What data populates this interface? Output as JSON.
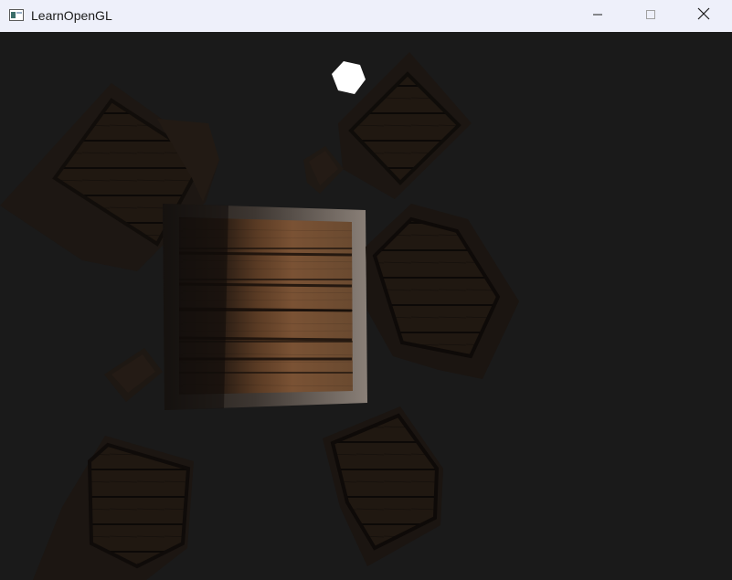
{
  "window": {
    "title": "LearnOpenGL",
    "app_icon": "window-app-icon",
    "controls": {
      "minimize_icon": "minimize-icon",
      "maximize_icon": "maximize-icon",
      "close_icon": "close-icon"
    }
  },
  "scene": {
    "background_color": "#1a1a1a",
    "light_color": "#ffffff",
    "crate_wood_color": "#6b4a32",
    "crate_edge_color": "#9a9088"
  }
}
